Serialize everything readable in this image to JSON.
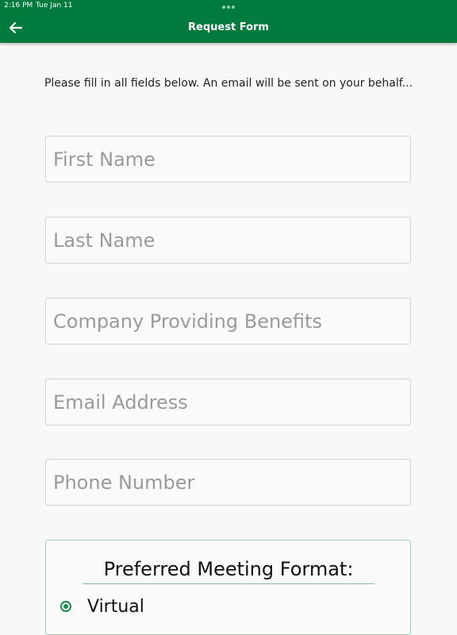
{
  "status_bar": {
    "time": "2:16 PM",
    "date": "Tue Jan 11"
  },
  "app_bar": {
    "title": "Request Form",
    "back_icon": "arrow-left-icon",
    "background_color": "#007a3d"
  },
  "form": {
    "instructions": "Please fill in all fields below. An email will be sent on your behalf...",
    "fields": [
      {
        "placeholder": "First Name",
        "value": ""
      },
      {
        "placeholder": "Last Name",
        "value": ""
      },
      {
        "placeholder": "Company Providing Benefits",
        "value": ""
      },
      {
        "placeholder": "Email Address",
        "value": ""
      },
      {
        "placeholder": "Phone Number",
        "value": ""
      }
    ],
    "meeting_format": {
      "title": "Preferred Meeting Format:",
      "options": [
        {
          "label": "Virtual",
          "selected": true
        }
      ]
    }
  }
}
